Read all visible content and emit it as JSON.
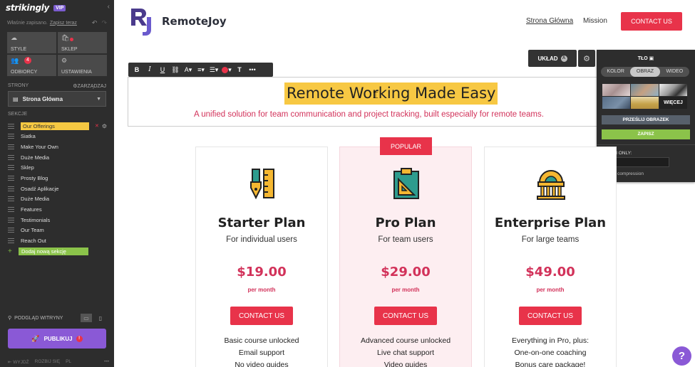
{
  "sidebar": {
    "logo": "strikingly",
    "vip": "VIP",
    "saved_text": "Właśnie zapisano.",
    "save_now": "Zapisz teraz",
    "grid": {
      "style": "STYLE",
      "shop": "SKLEP",
      "subscribers": "ODBIORCY",
      "subscribers_count": "4",
      "settings": "USTAWIENIA"
    },
    "pages_label": "STRONY",
    "manage": "ZARZĄDZAJ",
    "current_page": "Strona Główna",
    "sections_label": "SEKCJE",
    "sections": [
      "Our Offerings",
      "Siatka",
      "Make Your Own",
      "Duże Media",
      "Sklep",
      "Prosty Blog",
      "Osadź Aplikacje",
      "Duże Media",
      "Features",
      "Testimonials",
      "Our Team",
      "Reach Out"
    ],
    "add_section": "Dodaj nową sekcję",
    "preview": "PODGLĄD WITRYNY",
    "publish": "PUBLIKUJ",
    "publish_badge": "!",
    "footer": {
      "exit": "WYJDŹ",
      "expand": "ROZBIJ SIĘ",
      "lang": "PL",
      "more": "•••"
    }
  },
  "site": {
    "brand": "RemoteJoy",
    "nav": {
      "home": "Strona Główna",
      "mission": "Mission",
      "contact": "CONTACT US"
    },
    "hero_title": "Remote Working Made Easy",
    "hero_subtitle": "A unified solution for team communication and project tracking, built especially for remote teams."
  },
  "toolbar": {
    "bold": "B",
    "italic": "I",
    "underline": "U",
    "link": "🔗",
    "size": "A↕",
    "align": "≡",
    "list": "☰",
    "text": "T",
    "more": "•••"
  },
  "layout_btn": "UKŁAD",
  "layout_icon": "A",
  "bg_panel": {
    "title": "TŁO",
    "tabs": [
      "KOLOR",
      "OBRAZ",
      "WIDEO"
    ],
    "active_tab": "OBRAZ",
    "more": "WIĘCEJ",
    "upload": "PRZEŚLIJ OBRAZEK",
    "save": "ZAPISZ",
    "admin_only": "ADMIN ONLY:",
    "no_compression": "No compression"
  },
  "plans": [
    {
      "name": "Starter Plan",
      "subtitle": "For individual users",
      "price": "$19.00",
      "per": "per month",
      "button": "CONTACT US",
      "features": [
        "Basic course unlocked",
        "Email support",
        "No video guides"
      ]
    },
    {
      "name": "Pro Plan",
      "subtitle": "For team users",
      "price": "$29.00",
      "per": "per month",
      "button": "CONTACT US",
      "features": [
        "Advanced course unlocked",
        "Live chat support",
        "Video guides"
      ],
      "tag": "POPULAR"
    },
    {
      "name": "Enterprise Plan",
      "subtitle": "For large teams",
      "price": "$49.00",
      "per": "per month",
      "button": "CONTACT US",
      "features": [
        "Everything in Pro, plus:",
        "One-on-one coaching",
        "Bonus care package!"
      ]
    }
  ],
  "help": "?",
  "colors": {
    "accent": "#e8334a",
    "purple": "#8a59d6",
    "highlight": "#f7c843",
    "green": "#8bc34a",
    "navy": "#4a3a8c"
  }
}
